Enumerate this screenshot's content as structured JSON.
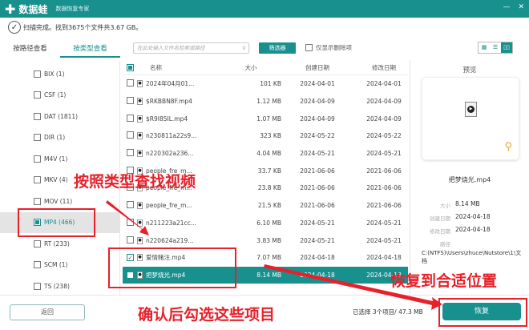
{
  "app": {
    "name": "数据蛙",
    "subtitle": "数据恢复专家",
    "win_buttons": [
      "—",
      "✕"
    ]
  },
  "status": "扫描完成。找到3675个文件共3.67 GB。",
  "tabs": [
    {
      "label": "按路径查看",
      "active": false
    },
    {
      "label": "按类型查看",
      "active": true
    }
  ],
  "toolbar": {
    "search_placeholder": "在此处输入文件名检索或路径",
    "filter_label": "筛选器",
    "only_deleted_label": "仅显示删除项",
    "views": [
      "grid-icon",
      "list-icon",
      "detail-icon"
    ]
  },
  "sidebar": {
    "items": [
      {
        "label": "BIX (1)"
      },
      {
        "label": "CSF (1)"
      },
      {
        "label": "DAT (1811)"
      },
      {
        "label": "DIR (1)"
      },
      {
        "label": "M4V (1)"
      },
      {
        "label": "MKV (4)"
      },
      {
        "label": "MOV (11)"
      },
      {
        "label": "MP4 (466)",
        "selected": true
      },
      {
        "label": "RT (233)"
      },
      {
        "label": "SCM (1)"
      },
      {
        "label": "TS (238)"
      }
    ]
  },
  "table": {
    "headers": [
      "名称",
      "大小",
      "创建日期",
      "修改日期"
    ],
    "rows": [
      {
        "name": "2024年04月01...",
        "size": "101 KB",
        "created": "2024-04-01",
        "modified": "2024-04-01",
        "checked": false
      },
      {
        "name": "$RKBBN8F.mp4",
        "size": "1.12 MB",
        "created": "2024-04-09",
        "modified": "2024-04-09",
        "checked": false
      },
      {
        "name": "$R9I85IL.mp4",
        "size": "1.07 MB",
        "created": "2024-04-09",
        "modified": "2024-04-09",
        "checked": false
      },
      {
        "name": "n230811a22s9...",
        "size": "323 KB",
        "created": "2024-05-22",
        "modified": "2024-05-22",
        "checked": false
      },
      {
        "name": "n220302a236...",
        "size": "4.04 MB",
        "created": "2024-05-21",
        "modified": "2024-05-21",
        "checked": false
      },
      {
        "name": "people_fre_m...",
        "size": "33.7 KB",
        "created": "2021-06-06",
        "modified": "2021-06-06",
        "checked": false
      },
      {
        "name": "people_fre_m...",
        "size": "23.8 KB",
        "created": "2021-06-06",
        "modified": "2021-06-06",
        "checked": false
      },
      {
        "name": "people_fre_m...",
        "size": "21.5 KB",
        "created": "2021-06-06",
        "modified": "2021-06-06",
        "checked": false
      },
      {
        "name": "n211223a21cc...",
        "size": "6.10 MB",
        "created": "2024-05-21",
        "modified": "2024-05-21",
        "checked": false
      },
      {
        "name": "n220624a219...",
        "size": "3.83 MB",
        "created": "2024-05-21",
        "modified": "2024-05-21",
        "checked": false
      },
      {
        "name": "爱情赌注.mp4",
        "size": "7.07 MB",
        "created": "2024-04-18",
        "modified": "2024-04-18",
        "checked": true
      },
      {
        "name": "把梦烧光.mp4",
        "size": "8.14 MB",
        "created": "2024-04-18",
        "modified": "2024-04-18",
        "checked": true,
        "selected": true
      }
    ]
  },
  "preview": {
    "title": "预览",
    "filename": "把梦烧光.mp4",
    "size_label": "大小",
    "size": "8.14 MB",
    "created_label": "创建日期",
    "created": "2024-04-18",
    "modified_label": "修改日期",
    "modified": "2024-04-18",
    "path_label": "路径",
    "path": "C:(NTFS)\\Users\\zhuce\\Nutstore\\1\\文档"
  },
  "bottom": {
    "back_label": "返回",
    "selected_text": "已选择 3个项目/ 47.3 MB",
    "recover_label": "恢复"
  },
  "annotations": {
    "find_by_type": "按照类型查找视频",
    "check_items": "确认后勾选这些项目",
    "recover_location": "恢复到合适位置",
    "color": "#e8202a"
  },
  "colors": {
    "accent": "#17908e"
  }
}
